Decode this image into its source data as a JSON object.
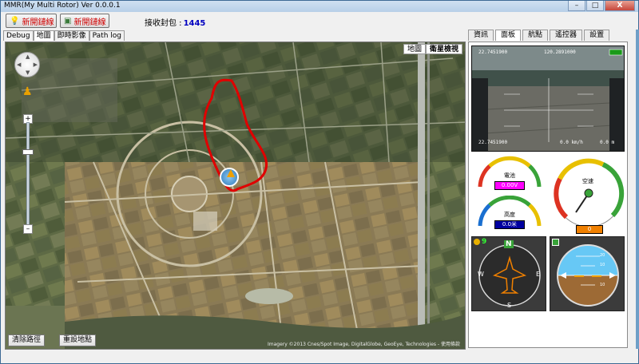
{
  "window": {
    "title": "MMR(My Multi Rotor) Ver 0.0.0.1",
    "controls": [
      "–",
      "□",
      "X"
    ]
  },
  "toolbar": {
    "connect_label": "新開鏈線",
    "toggle_label": "新開鏈線",
    "recv_label": "接收封包 :",
    "recv_count": "1445"
  },
  "left_tabs": [
    "Debug",
    "地圖",
    "即時影像",
    "Path log"
  ],
  "left_active_tab": "地圖",
  "map": {
    "type_buttons": [
      "地圖",
      "衛星檢視"
    ],
    "active_type": "衛星檢視",
    "zoom_in": "+",
    "zoom_out": "–",
    "clear_path_label": "清除路徑",
    "reset_map_label": "重設地點",
    "copyright": "Imagery ©2013 Cnes/Spot Image, DigitalGlobe, GeoEye, Technologies - 使用條款",
    "path_color": "#e00000"
  },
  "right_tabs": [
    "資訊",
    "面板",
    "航點",
    "遙控器",
    "設置"
  ],
  "right_active_tab": "面板",
  "video": {
    "osd_top_left": "22.7451900",
    "osd_top_mid": "120.2891000",
    "osd_bottom": "22.7451900",
    "osd_speed": "0.0 km/h",
    "osd_alt": "0.0 m"
  },
  "gauges": {
    "battery": {
      "label": "電池",
      "value": "0.00V"
    },
    "airspeed": {
      "label": "空速",
      "value": "0"
    },
    "altitude": {
      "label": "高度",
      "value": "0.0米"
    }
  },
  "indicators": {
    "satellites": "9",
    "compass": {
      "n": "N",
      "e": "E",
      "s": "S",
      "w": "W"
    },
    "horizon_scale": [
      "10",
      "20",
      "10"
    ]
  },
  "colors": {
    "title_bg": "#b7cfe8",
    "accent_red": "#d00000",
    "recv_blue": "#0000c0",
    "gauge_magenta": "#ff00ff",
    "gauge_blue": "#0000a0",
    "gauge_orange": "#f08000",
    "sky": "#67c8f5",
    "ground": "#9d6a35"
  }
}
